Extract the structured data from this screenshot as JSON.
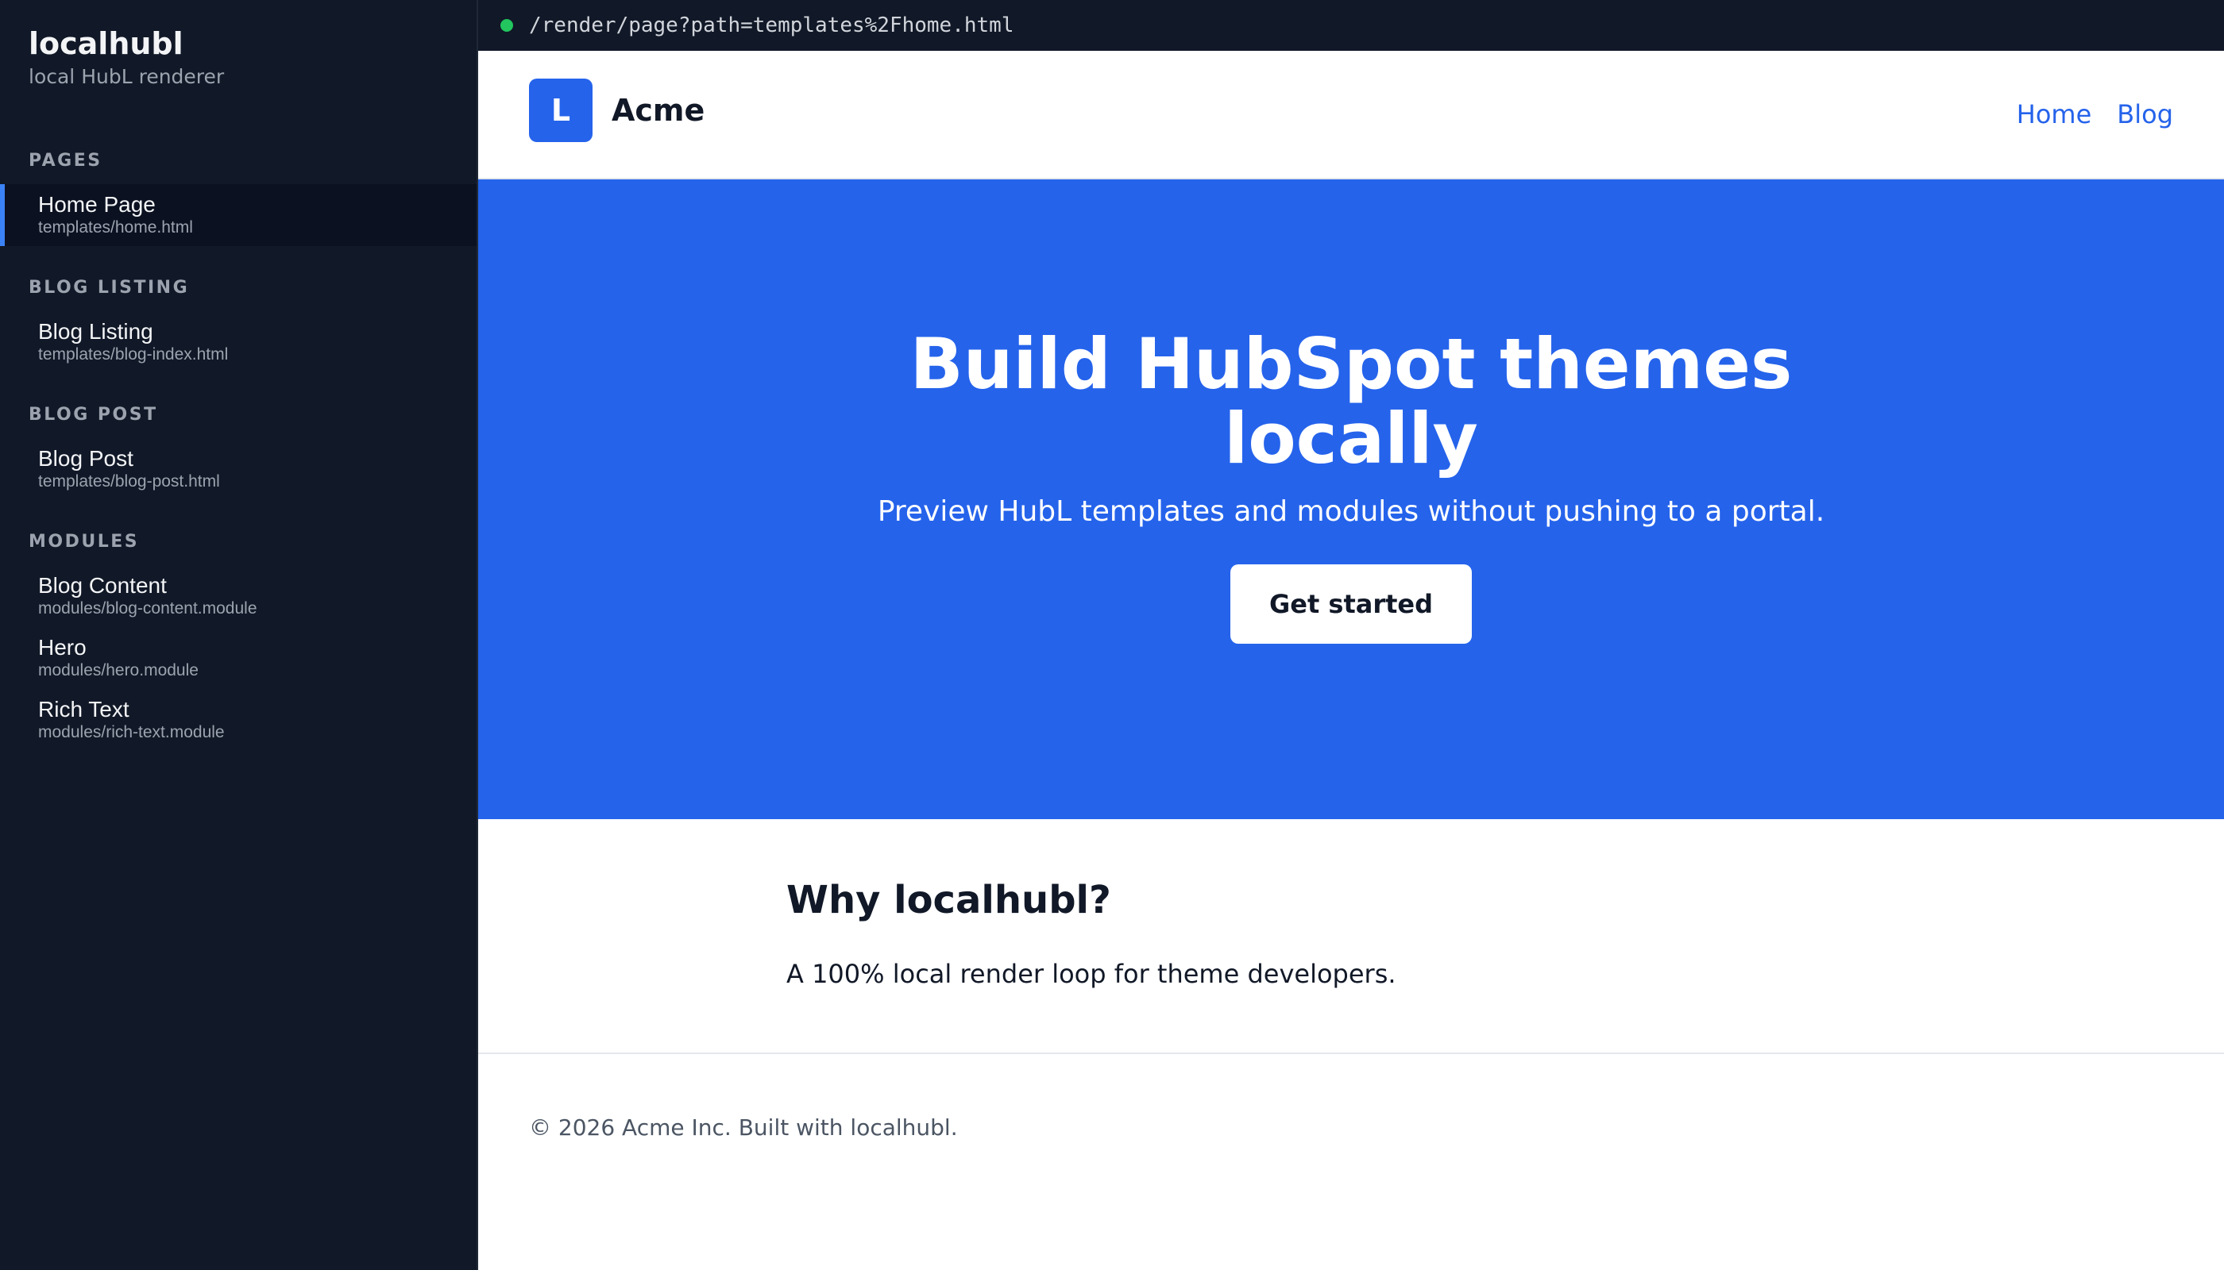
{
  "sidebar": {
    "title": "localhubl",
    "subtitle": "local HubL renderer",
    "sections": [
      {
        "label": "PAGES",
        "items": [
          {
            "name": "Home Page",
            "path": "templates/home.html",
            "active": true
          }
        ]
      },
      {
        "label": "BLOG LISTING",
        "items": [
          {
            "name": "Blog Listing",
            "path": "templates/blog-index.html"
          }
        ]
      },
      {
        "label": "BLOG POST",
        "items": [
          {
            "name": "Blog Post",
            "path": "templates/blog-post.html"
          }
        ]
      },
      {
        "label": "MODULES",
        "items": [
          {
            "name": "Blog Content",
            "path": "modules/blog-content.module"
          },
          {
            "name": "Hero",
            "path": "modules/hero.module"
          },
          {
            "name": "Rich Text",
            "path": "modules/rich-text.module"
          }
        ]
      }
    ]
  },
  "urlbar": {
    "url": "/render/page?path=templates%2Fhome.html",
    "status_color": "#22c55e"
  },
  "site": {
    "logo_letter": "L",
    "brand": "Acme",
    "nav": {
      "home": "Home",
      "blog": "Blog"
    },
    "hero": {
      "title": "Build HubSpot themes locally",
      "subtitle": "Preview HubL templates and modules without pushing to a portal.",
      "cta": "Get started",
      "background": "#2563eb"
    },
    "content": {
      "heading": "Why localhubl?",
      "body": "A 100% local render loop for theme developers."
    },
    "footer": "© 2026 Acme Inc. Built with localhubl."
  },
  "colors": {
    "sidebar_bg": "#111827",
    "accent": "#2563eb",
    "active_indicator": "#3b82f6"
  }
}
